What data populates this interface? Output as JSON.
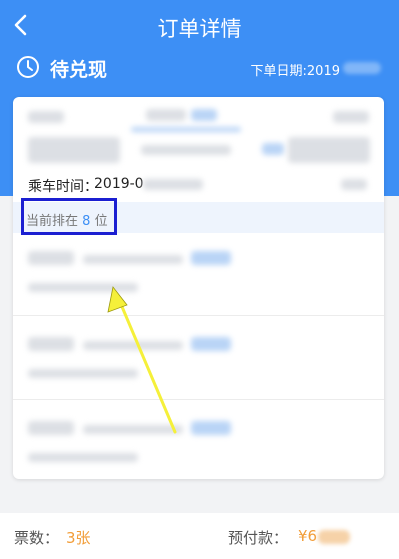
{
  "nav": {
    "title": "订单详情"
  },
  "status": {
    "label": "待兑现",
    "order_date": "下单日期:2019"
  },
  "card": {
    "seat_time_label": "乘车时间：",
    "seat_time_value": "2019-0",
    "queue_prefix": "当前排在",
    "queue_position": "8",
    "queue_suffix": "位"
  },
  "footer": {
    "tickets_label": "票数：",
    "tickets_value": "3张",
    "prepay_label": "预付款：",
    "prepay_value": "¥6"
  },
  "colors": {
    "primary": "#3d8ff5",
    "accent": "#f29d38",
    "highlight_box": "#1b1fd1",
    "annotation_arrow": "#f5f03a"
  },
  "icons": [
    "back-arrow-icon",
    "clock-icon"
  ]
}
